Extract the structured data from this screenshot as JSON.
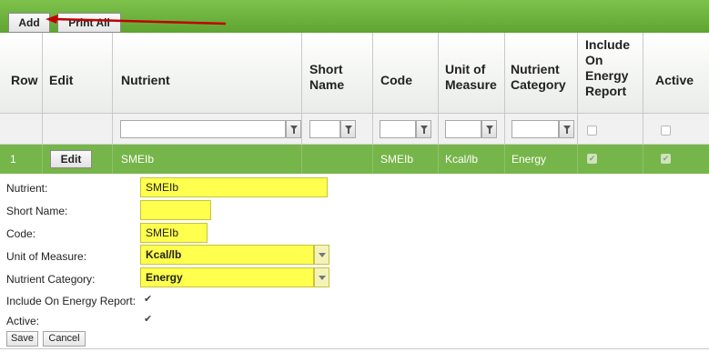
{
  "toolbar": {
    "add_label": "Add",
    "print_all_label": "Print All"
  },
  "columns": {
    "row": "Row",
    "edit": "Edit",
    "nutrient": "Nutrient",
    "short_name": [
      "Short",
      "Name"
    ],
    "code": "Code",
    "unit_of_measure": [
      "Unit of",
      "Measure"
    ],
    "nutrient_category": [
      "Nutrient",
      "Category"
    ],
    "include_on_energy_report": [
      "Include",
      "On",
      "Energy",
      "Report"
    ],
    "active": "Active"
  },
  "row": {
    "number": "1",
    "edit_label": "Edit",
    "nutrient": "SMEIb",
    "short_name": "",
    "code": "SMEIb",
    "unit_of_measure": "Kcal/lb",
    "nutrient_category": "Energy",
    "include_on_energy_report": true,
    "active": true
  },
  "form": {
    "nutrient_label": "Nutrient:",
    "nutrient_value": "SMEIb",
    "short_name_label": "Short Name:",
    "short_name_value": "",
    "code_label": "Code:",
    "code_value": "SMEIb",
    "unit_label": "Unit of Measure:",
    "unit_value": "Kcal/lb",
    "category_label": "Nutrient Category:",
    "category_value": "Energy",
    "include_label": "Include On Energy Report:",
    "include_checked": true,
    "active_label": "Active:",
    "active_checked": true,
    "save_label": "Save",
    "cancel_label": "Cancel"
  },
  "colors": {
    "toolbar_green": "#6db43e",
    "selected_row_green": "#76b54a",
    "highlight_yellow": "#ffff4d",
    "annotation_arrow": "#c00000"
  },
  "icons": {
    "filter": "funnel-icon",
    "dropdown": "chevron-down-icon",
    "checkbox": "checkmark-icon",
    "annotation": "red-arrow-annotation"
  }
}
